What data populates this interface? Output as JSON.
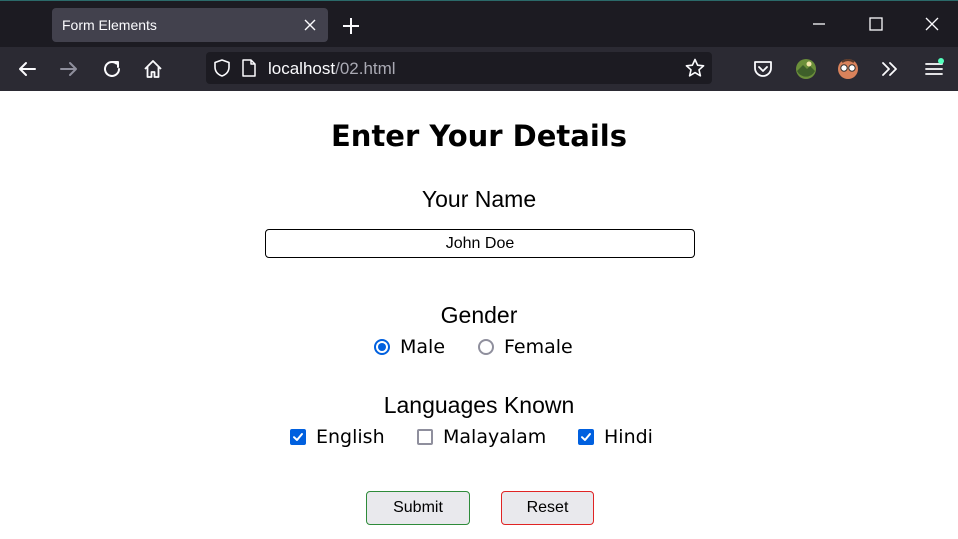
{
  "browser": {
    "tab_title": "Form Elements",
    "url_host": "localhost",
    "url_path": "/02.html"
  },
  "form": {
    "heading": "Enter Your Details",
    "name_label": "Your Name",
    "name_value": "John Doe",
    "gender_label": "Gender",
    "gender_options": [
      {
        "label": "Male",
        "selected": true
      },
      {
        "label": "Female",
        "selected": false
      }
    ],
    "languages_label": "Languages Known",
    "language_options": [
      {
        "label": "English",
        "checked": true
      },
      {
        "label": "Malayalam",
        "checked": false
      },
      {
        "label": "Hindi",
        "checked": true
      }
    ],
    "submit_label": "Submit",
    "reset_label": "Reset"
  },
  "colors": {
    "accent": "#0060df",
    "submit_border": "#2e8b3a",
    "reset_border": "#e02424"
  }
}
